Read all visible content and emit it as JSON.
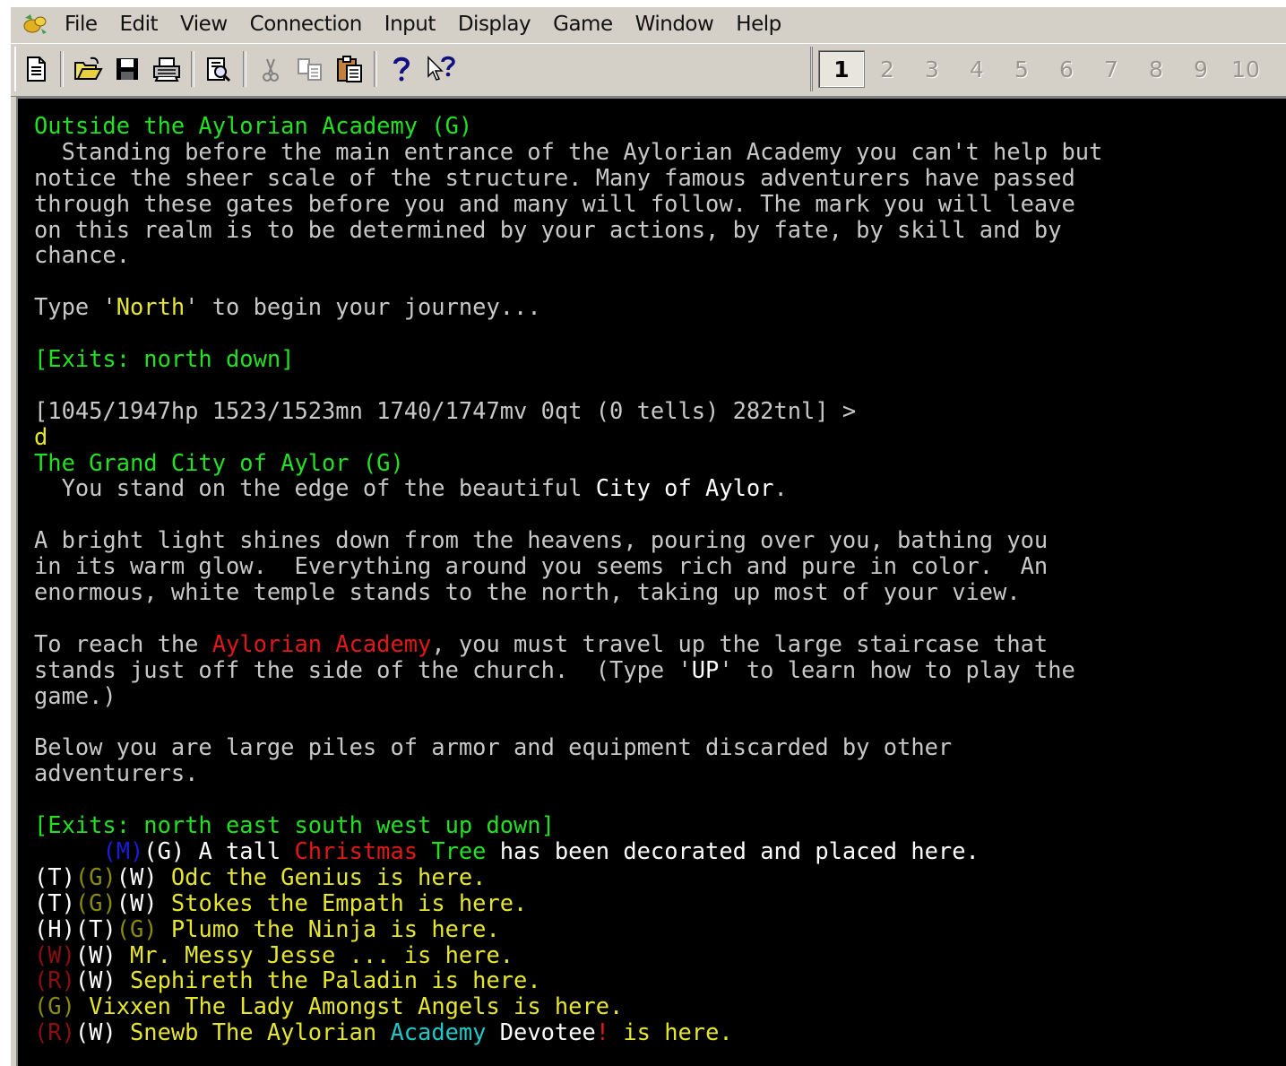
{
  "menu": {
    "items": [
      "File",
      "Edit",
      "View",
      "Connection",
      "Input",
      "Display",
      "Game",
      "Window",
      "Help"
    ]
  },
  "toolbar": {
    "icons": [
      "new-document-icon",
      "open-folder-icon",
      "save-icon",
      "print-icon",
      "print-preview-icon",
      "cut-icon",
      "copy-icon",
      "paste-icon",
      "help-icon",
      "context-help-icon"
    ],
    "tabs": [
      "1",
      "2",
      "3",
      "4",
      "5",
      "6",
      "7",
      "8",
      "9",
      "10"
    ],
    "active_tab": "1"
  },
  "colors": {
    "terminal_bg": "#000000",
    "room_name": "#22e022",
    "exits": "#22e022",
    "prompt": "#c8c8c8",
    "description": "#c0c0c0",
    "highlight_red": "#e01818"
  },
  "terminal": {
    "lines": [
      [
        {
          "t": "Outside the Aylorian Academy (G)",
          "c": "green"
        }
      ],
      [
        {
          "t": "  Standing before the main entrance of the Aylorian Academy you can't help but",
          "c": "grey"
        }
      ],
      [
        {
          "t": "notice the sheer scale of the structure. Many famous adventurers have passed",
          "c": "grey"
        }
      ],
      [
        {
          "t": "through these gates before you and many will follow. The mark you will leave",
          "c": "grey"
        }
      ],
      [
        {
          "t": "on this realm is to be determined by your actions, by fate, by skill and by",
          "c": "grey"
        }
      ],
      [
        {
          "t": "chance.",
          "c": "grey"
        }
      ],
      [
        {
          "t": "",
          "c": "grey"
        }
      ],
      [
        {
          "t": "Type '",
          "c": "grey"
        },
        {
          "t": "North",
          "c": "yellow"
        },
        {
          "t": "' to begin your journey...",
          "c": "grey"
        }
      ],
      [
        {
          "t": "",
          "c": "grey"
        }
      ],
      [
        {
          "t": "[Exits: north down]",
          "c": "green"
        }
      ],
      [
        {
          "t": "",
          "c": "grey"
        }
      ],
      [
        {
          "t": "[1045/1947hp 1523/1523mn 1740/1747mv 0qt (0 tells) 282tnl] >",
          "c": "grey"
        }
      ],
      [
        {
          "t": "d",
          "c": "yellow"
        }
      ],
      [
        {
          "t": "The Grand City of Aylor (G)",
          "c": "green"
        }
      ],
      [
        {
          "t": "  You stand on the edge of the beautiful ",
          "c": "grey"
        },
        {
          "t": "City of Aylor",
          "c": "white"
        },
        {
          "t": ".",
          "c": "grey"
        }
      ],
      [
        {
          "t": "",
          "c": "grey"
        }
      ],
      [
        {
          "t": "A bright light shines down from the heavens, pouring over you, bathing you",
          "c": "grey"
        }
      ],
      [
        {
          "t": "in its warm glow.  Everything around you seems rich and pure in color.  An",
          "c": "grey"
        }
      ],
      [
        {
          "t": "enormous, white temple stands to the north, taking up most of your view.",
          "c": "grey"
        }
      ],
      [
        {
          "t": "",
          "c": "grey"
        }
      ],
      [
        {
          "t": "To reach the ",
          "c": "grey"
        },
        {
          "t": "Aylorian Academy",
          "c": "red"
        },
        {
          "t": ", you must travel up the large staircase that",
          "c": "grey"
        }
      ],
      [
        {
          "t": "stands just off the side of the church.  (Type '",
          "c": "grey"
        },
        {
          "t": "UP",
          "c": "white"
        },
        {
          "t": "' to learn how to play the",
          "c": "grey"
        }
      ],
      [
        {
          "t": "game.)",
          "c": "grey"
        }
      ],
      [
        {
          "t": "",
          "c": "grey"
        }
      ],
      [
        {
          "t": "Below you are large piles of armor and equipment discarded by other",
          "c": "grey"
        }
      ],
      [
        {
          "t": "adventurers.",
          "c": "grey"
        }
      ],
      [
        {
          "t": "",
          "c": "grey"
        }
      ],
      [
        {
          "t": "[Exits: north east south west up down]",
          "c": "green"
        }
      ],
      [
        {
          "t": "     ",
          "c": "grey"
        },
        {
          "t": "(M)",
          "c": "blue"
        },
        {
          "t": "(G) A tall ",
          "c": "white"
        },
        {
          "t": "Christmas",
          "c": "red"
        },
        {
          "t": " Tree",
          "c": "green"
        },
        {
          "t": " has been decorated and placed here.",
          "c": "white"
        }
      ],
      [
        {
          "t": "(T)",
          "c": "white"
        },
        {
          "t": "(G)",
          "c": "olive"
        },
        {
          "t": "(W) ",
          "c": "white"
        },
        {
          "t": "Odc the Genius is here.",
          "c": "yellow"
        }
      ],
      [
        {
          "t": "(T)",
          "c": "white"
        },
        {
          "t": "(G)",
          "c": "olive"
        },
        {
          "t": "(W) ",
          "c": "white"
        },
        {
          "t": "Stokes the Empath is here.",
          "c": "yellow"
        }
      ],
      [
        {
          "t": "(H)(T)",
          "c": "white"
        },
        {
          "t": "(G) ",
          "c": "olive"
        },
        {
          "t": "Plumo the Ninja is here.",
          "c": "yellow"
        }
      ],
      [
        {
          "t": "(W)",
          "c": "darkred"
        },
        {
          "t": "(W) ",
          "c": "white"
        },
        {
          "t": "Mr. Messy Jesse ... is here.",
          "c": "yellow"
        }
      ],
      [
        {
          "t": "(R)",
          "c": "darkred"
        },
        {
          "t": "(W) ",
          "c": "white"
        },
        {
          "t": "Sephireth the Paladin is here.",
          "c": "yellow"
        }
      ],
      [
        {
          "t": "(G) ",
          "c": "olive"
        },
        {
          "t": "Vixxen The Lady Amongst Angels is here.",
          "c": "yellow"
        }
      ],
      [
        {
          "t": "(R)",
          "c": "darkred"
        },
        {
          "t": "(W) ",
          "c": "white"
        },
        {
          "t": "Snewb The Aylorian ",
          "c": "yellow"
        },
        {
          "t": "Academy",
          "c": "cyan"
        },
        {
          "t": " Devotee",
          "c": "white"
        },
        {
          "t": "!",
          "c": "red"
        },
        {
          "t": " is here.",
          "c": "yellow"
        }
      ]
    ]
  }
}
